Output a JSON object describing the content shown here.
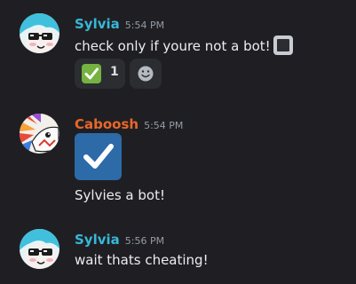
{
  "messages": [
    {
      "author": "Sylvia",
      "author_color": "#37b8d7",
      "time": "5:54 PM",
      "text": "check only if youre not a bot!",
      "reactions": [
        {
          "emoji": "white-check-mark-icon",
          "count": "1"
        }
      ],
      "inline_emoji": "black-square-icon"
    },
    {
      "author": "Caboosh",
      "author_color": "#e8672a",
      "time": "5:54 PM",
      "attachment_emoji": "ballot-box-check-icon",
      "text": "Sylvies a bot!"
    },
    {
      "author": "Sylvia",
      "author_color": "#37b8d7",
      "time": "5:56 PM",
      "text": "wait thats cheating!"
    }
  ],
  "colors": {
    "background": "#1f1f23",
    "reaction_bg": "#2b2d31",
    "check_green": "#75b240",
    "check_blue": "#2c6aa8"
  }
}
